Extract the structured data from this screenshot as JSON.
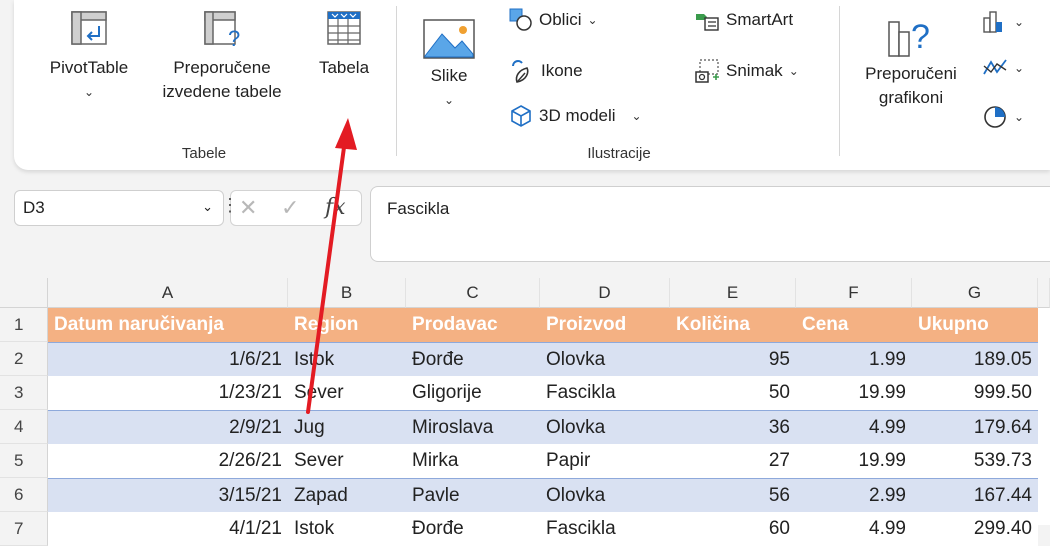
{
  "ribbon": {
    "tabele": {
      "group_title": "Tabele",
      "pivot_line1": "PivotTable",
      "pivot_caret": "⌄",
      "recommended_line1": "Preporučene",
      "recommended_line2": "izvedene tabele",
      "table_label": "Tabela"
    },
    "ilustracije": {
      "group_title": "Ilustracije",
      "pictures_label": "Slike",
      "pictures_caret": "⌄",
      "shapes_label": "Oblici",
      "icons_label": "Ikone",
      "models_label": "3D modeli",
      "smartart_label": "SmartArt",
      "screenshot_label": "Snimak"
    },
    "charts": {
      "recommended_line1": "Preporučeni",
      "recommended_line2": "grafikoni"
    }
  },
  "formula_bar": {
    "name_box": "D3",
    "formula": "Fascikla",
    "fx": "fx"
  },
  "sheet": {
    "columns": [
      "A",
      "B",
      "C",
      "D",
      "E",
      "F",
      "G"
    ],
    "row_numbers": [
      "1",
      "2",
      "3",
      "4",
      "5",
      "6",
      "7"
    ],
    "header": [
      "Datum naručivanja",
      "Region",
      "Prodavac",
      "Proizvod",
      "Količina",
      "Cena",
      "Ukupno"
    ],
    "rows": [
      [
        "1/6/21",
        "Istok",
        "Đorđe",
        "Olovka",
        "95",
        "1.99",
        "189.05"
      ],
      [
        "1/23/21",
        "Sever",
        "Gligorije",
        "Fascikla",
        "50",
        "19.99",
        "999.50"
      ],
      [
        "2/9/21",
        "Jug",
        "Miroslava",
        "Olovka",
        "36",
        "4.99",
        "179.64"
      ],
      [
        "2/26/21",
        "Sever",
        "Mirka",
        "Papir",
        "27",
        "19.99",
        "539.73"
      ],
      [
        "3/15/21",
        "Zapad",
        "Pavle",
        "Olovka",
        "56",
        "2.99",
        "167.44"
      ],
      [
        "4/1/21",
        "Istok",
        "Đorđe",
        "Fascikla",
        "60",
        "4.99",
        "299.40"
      ]
    ]
  },
  "colors": {
    "header_fill": "#f4b183",
    "band_fill": "#d9e1f2",
    "arrow": "#e31b23"
  }
}
